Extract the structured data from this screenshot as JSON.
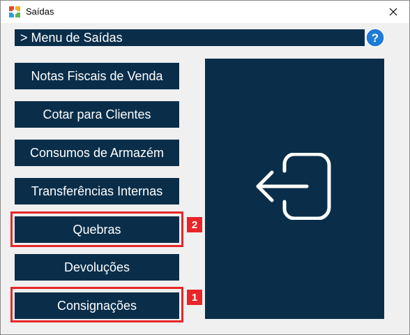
{
  "window": {
    "title": "Saídas",
    "app_icon": "saidas-app-icon",
    "close_icon": "close-icon"
  },
  "header": {
    "title": "> Menu de Saídas",
    "help_icon": "help-icon"
  },
  "menu": {
    "notas_fiscais": "Notas Fiscais de Venda",
    "cotar_clientes": "Cotar para Clientes",
    "consumos_armazem": "Consumos de Armazém",
    "transferencias": "Transferências Internas",
    "quebras": "Quebras",
    "devolucoes": "Devoluções",
    "consignacoes": "Consignações"
  },
  "exit_panel": {
    "icon": "exit-icon"
  },
  "annotations": {
    "badge_1": "1",
    "badge_2": "2",
    "color": "#e8262a"
  },
  "theme": {
    "navy": "#0a2e4a",
    "help_blue": "#1e7bd6"
  }
}
